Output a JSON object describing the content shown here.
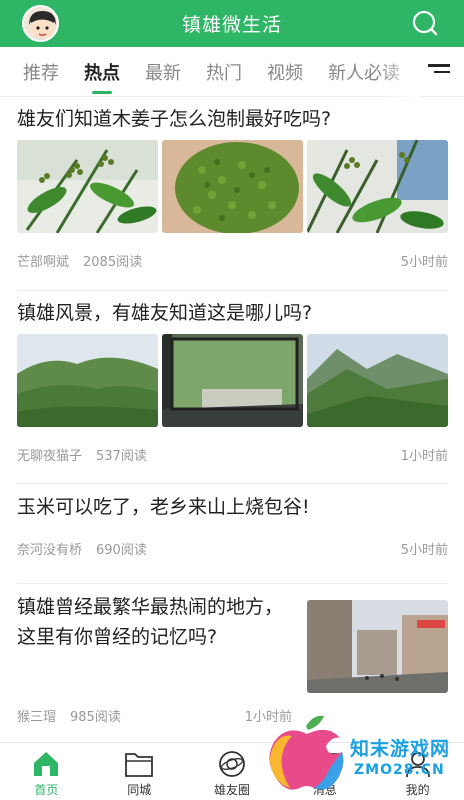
{
  "header": {
    "title": "镇雄微生活"
  },
  "tabs": [
    {
      "label": "推荐",
      "active": false
    },
    {
      "label": "热点",
      "active": true
    },
    {
      "label": "最新",
      "active": false
    },
    {
      "label": "热门",
      "active": false
    },
    {
      "label": "视频",
      "active": false
    },
    {
      "label": "新人必读",
      "active": false
    }
  ],
  "posts": [
    {
      "title": "雄友们知道木姜子怎么泡制最好吃吗?",
      "author": "芒部啊斌",
      "reads": "2085阅读",
      "time": "5小时前"
    },
    {
      "title": "镇雄风景，有雄友知道这是哪儿吗?",
      "author": "无聊夜猫子",
      "reads": "537阅读",
      "time": "1小时前"
    },
    {
      "title": "玉米可以吃了，老乡来山上烧包谷!",
      "author": "奈河没有桥",
      "reads": "690阅读",
      "time": "5小时前"
    },
    {
      "title": "镇雄曾经最繁华最热闹的地方，这里有你曾经的记忆吗?",
      "author": "猴三瑁",
      "reads": "985阅读",
      "time": "1小时前"
    }
  ],
  "bottom_nav": [
    {
      "label": "首页",
      "icon": "home-icon",
      "active": true
    },
    {
      "label": "同城",
      "icon": "folder-icon",
      "active": false
    },
    {
      "label": "雄友圈",
      "icon": "planet-icon",
      "active": false
    },
    {
      "label": "消息",
      "icon": "message-icon",
      "active": false
    },
    {
      "label": "我的",
      "icon": "user-icon",
      "active": false
    }
  ],
  "watermark": {
    "text": "知末游戏网",
    "url": "ZMO28.CN"
  },
  "colors": {
    "brand_green": "#2eb566",
    "watermark_blue": "#1aa0e0"
  }
}
